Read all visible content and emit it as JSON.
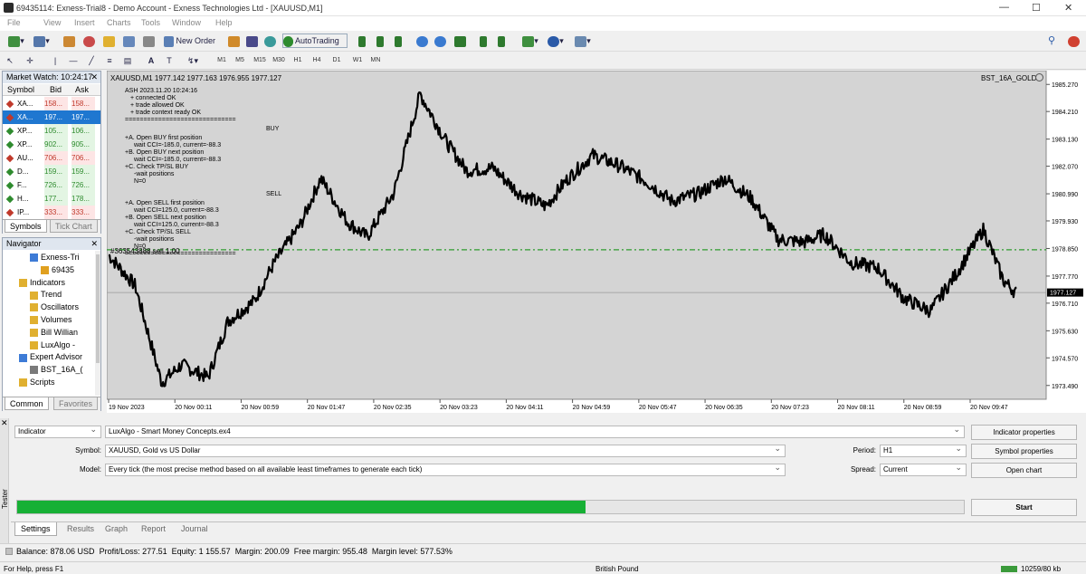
{
  "window": {
    "title": "69435114: Exness-Trial8 - Demo Account - Exness Technologies Ltd - [XAUUSD,M1]",
    "minimize": "—",
    "restore": "☐",
    "close": "✕"
  },
  "menu": [
    "File",
    "View",
    "Insert",
    "Charts",
    "Tools",
    "Window",
    "Help"
  ],
  "toolbar": {
    "new_order": "New Order",
    "autotrading": "AutoTrading"
  },
  "timeframes": [
    "M1",
    "M5",
    "M15",
    "M30",
    "H1",
    "H4",
    "D1",
    "W1",
    "MN"
  ],
  "market_watch": {
    "title": "Market Watch: 10:24:17",
    "headers": [
      "Symbol",
      "Bid",
      "Ask"
    ],
    "rows": [
      {
        "symbol": "XA...",
        "bid": "158...",
        "ask": "158...",
        "color": "#c0392b",
        "selected": false
      },
      {
        "symbol": "XA...",
        "bid": "197...",
        "ask": "197...",
        "color": "#c0392b",
        "selected": true
      },
      {
        "symbol": "XP...",
        "bid": "105...",
        "ask": "106...",
        "color": "#2e8b2e",
        "selected": false
      },
      {
        "symbol": "XP...",
        "bid": "902...",
        "ask": "905...",
        "color": "#2e8b2e",
        "selected": false
      },
      {
        "symbol": "AU...",
        "bid": "706...",
        "ask": "706...",
        "color": "#c0392b",
        "selected": false
      },
      {
        "symbol": "D...",
        "bid": "159...",
        "ask": "159...",
        "color": "#2e8b2e",
        "selected": false
      },
      {
        "symbol": "F...",
        "bid": "726...",
        "ask": "726...",
        "color": "#2e8b2e",
        "selected": false
      },
      {
        "symbol": "H...",
        "bid": "177...",
        "ask": "178...",
        "color": "#2e8b2e",
        "selected": false
      },
      {
        "symbol": "IP...",
        "bid": "333...",
        "ask": "333...",
        "color": "#c0392b",
        "selected": false
      }
    ],
    "tabs": [
      "Symbols",
      "Tick Chart"
    ]
  },
  "navigator": {
    "title": "Navigator",
    "items": [
      {
        "label": "Exness-Tri",
        "indent": 2,
        "color": "#3d7bd6"
      },
      {
        "label": "69435",
        "indent": 3,
        "color": "#e0a020"
      },
      {
        "label": "Indicators",
        "indent": 1,
        "color": "#e0b030"
      },
      {
        "label": "Trend",
        "indent": 2,
        "color": "#e0b030"
      },
      {
        "label": "Oscillators",
        "indent": 2,
        "color": "#e0b030"
      },
      {
        "label": "Volumes",
        "indent": 2,
        "color": "#e0b030"
      },
      {
        "label": "Bill Willian",
        "indent": 2,
        "color": "#e0b030"
      },
      {
        "label": "LuxAlgo -",
        "indent": 2,
        "color": "#e0b030"
      },
      {
        "label": "Expert Advisor",
        "indent": 1,
        "color": "#3d7bd6"
      },
      {
        "label": "BST_16A_(",
        "indent": 2,
        "color": "#7a7a7a"
      },
      {
        "label": "Scripts",
        "indent": 1,
        "color": "#e0b030"
      }
    ],
    "tabs": [
      "Common",
      "Favorites"
    ]
  },
  "chart": {
    "header": "XAUUSD,M1  1977.142 1977.163 1976.955 1977.127",
    "ea_name": "BST_16A_GOLD",
    "comment": [
      "ASH  2023.11.20 10:24:16",
      "+ connected  OK",
      "+ trade allowed  OK",
      "+ trade context ready  OK",
      "==============================",
      "BUY",
      "+A. Open BUY first position",
      "wait CCI=-185.0, current=-88.3",
      "+B. Open BUY next position",
      "wait CCI=-185.0, current=-88.3",
      "+C. Check TP/SL BUY",
      "-wait positions",
      "N=0",
      "SELL",
      "+A. Open SELL first position",
      "wait CCI=125.0, current=-88.3",
      "+B. Open SELL next position",
      "wait CCI=125.0, current=-88.3",
      "+C. Check TP/SL SELL",
      "-wait positions",
      "N=0",
      "=============================="
    ],
    "order_label": "#363543888 sell 1.00",
    "current_price": "1977.127"
  },
  "chart_data": {
    "type": "line",
    "ylim": [
      1972.95,
      1985.81
    ],
    "y_ticks": [
      "1985.270",
      "1984.210",
      "1983.130",
      "1982.070",
      "1980.990",
      "1979.930",
      "1978.850",
      "1977.770",
      "1976.710",
      "1975.630",
      "1974.570",
      "1973.490"
    ],
    "x_ticks": [
      "19 Nov 2023",
      "20 Nov 00:11",
      "20 Nov 00:59",
      "20 Nov 01:47",
      "20 Nov 02:35",
      "20 Nov 03:23",
      "20 Nov 04:11",
      "20 Nov 04:59",
      "20 Nov 05:47",
      "20 Nov 06:35",
      "20 Nov 07:23",
      "20 Nov 08:11",
      "20 Nov 08:59",
      "20 Nov 09:47"
    ],
    "order_level": 1978.8,
    "current_price": 1977.127,
    "series": [
      {
        "x": [
          0,
          0.4,
          0.8,
          1.1,
          1.5,
          1.8,
          2.2,
          2.5,
          2.9,
          3.2,
          3.6,
          3.9,
          4.3,
          4.7,
          5.1,
          5.4,
          5.8,
          6.2,
          6.6,
          6.9,
          7.3,
          7.7,
          8.1,
          8.5,
          8.9,
          9.3,
          9.7,
          10.1,
          10.5,
          10.8,
          11.2,
          11.6,
          12.0,
          12.4,
          12.8,
          13.2,
          13.5,
          13.7
        ],
        "values": [
          1978.6,
          1977.4,
          1973.6,
          1974.3,
          1973.8,
          1976.0,
          1976.8,
          1978.3,
          1979.8,
          1981.6,
          1979.9,
          1979.3,
          1981.0,
          1984.9,
          1983.0,
          1981.9,
          1982.0,
          1981.0,
          1980.5,
          1981.5,
          1982.5,
          1982.1,
          1981.5,
          1980.7,
          1981.0,
          1981.6,
          1980.8,
          1979.2,
          1979.1,
          1979.4,
          1978.3,
          1978.1,
          1976.9,
          1976.4,
          1977.9,
          1979.6,
          1977.6,
          1977.1
        ]
      }
    ]
  },
  "tester": {
    "type_select": "Indicator",
    "indicator": "LuxAlgo - Smart Money Concepts.ex4",
    "symbol_label": "Symbol:",
    "symbol": "XAUUSD, Gold vs US Dollar",
    "model_label": "Model:",
    "model": "Every tick (the most precise method based on all available least timeframes to generate each tick)",
    "period_label": "Period:",
    "period": "H1",
    "spread_label": "Spread:",
    "spread": "Current",
    "btn_indicator_props": "Indicator properties",
    "btn_symbol_props": "Symbol properties",
    "btn_open_chart": "Open chart",
    "btn_start": "Start",
    "progress": 0.6,
    "tabs": [
      "Settings",
      "Results",
      "Graph",
      "Report",
      "Journal"
    ],
    "side_label": "Tester"
  },
  "account": {
    "balance": "Balance: 878.06 USD",
    "profit": "Profit/Loss: 277.51",
    "equity": "Equity: 1 155.57",
    "margin": "Margin: 200.09",
    "free_margin": "Free margin: 955.48",
    "margin_level": "Margin level: 577.53%"
  },
  "statusbar": {
    "help": "For Help, press F1",
    "profile": "British Pound",
    "traffic": "10259/80 kb"
  },
  "colors": {
    "chart_bg": "#d4d4d4",
    "candles": "#000000",
    "order_line": "#2e9b2e",
    "progress": "#17b035",
    "selected_row": "#1f77d0"
  }
}
